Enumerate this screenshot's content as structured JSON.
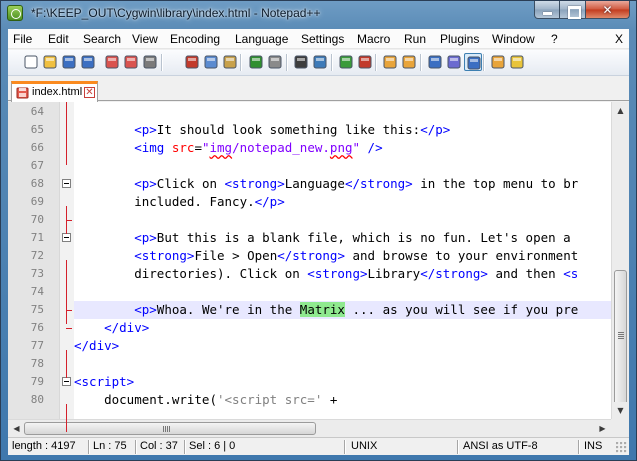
{
  "window": {
    "title": "*F:\\KEEP_OUT\\Cygwin\\library\\index.html - Notepad++",
    "minimize_glyph": "",
    "maximize_glyph": "",
    "close_glyph": "✕"
  },
  "menu": {
    "items": [
      "File",
      "Edit",
      "Search",
      "View",
      "Encoding",
      "Language",
      "Settings",
      "Macro",
      "Run",
      "Plugins",
      "Window",
      "?"
    ],
    "close": "X"
  },
  "toolbar": {
    "buttons": [
      {
        "name": "new-file-icon",
        "color": "#ffffff"
      },
      {
        "name": "open-file-icon",
        "color": "#f0c040"
      },
      {
        "name": "save-icon",
        "color": "#3b6fc2"
      },
      {
        "name": "save-all-icon",
        "color": "#3b6fc2"
      },
      {
        "name": "close-file-icon",
        "color": "#d9534f"
      },
      {
        "name": "close-all-icon",
        "color": "#d9534f"
      },
      {
        "name": "print-icon",
        "color": "#7a7a7a"
      },
      {
        "name": "cut-icon",
        "color": "#c23a2b"
      },
      {
        "name": "copy-icon",
        "color": "#5b8bd0"
      },
      {
        "name": "paste-icon",
        "color": "#c8a14a"
      },
      {
        "name": "undo-icon",
        "color": "#2f8f2f"
      },
      {
        "name": "redo-icon",
        "color": "#8a8a8a"
      },
      {
        "name": "find-icon",
        "color": "#3d3d3d"
      },
      {
        "name": "replace-icon",
        "color": "#3d7ab8"
      },
      {
        "name": "zoom-in-icon",
        "color": "#3b9b3b"
      },
      {
        "name": "zoom-out-icon",
        "color": "#c23a2b"
      },
      {
        "name": "sync-vertical-icon",
        "color": "#e8a43a"
      },
      {
        "name": "sync-horizontal-icon",
        "color": "#e8a43a"
      },
      {
        "name": "word-wrap-icon",
        "color": "#3b6fc2"
      },
      {
        "name": "show-all-chars-icon",
        "color": "#6b6bd0"
      },
      {
        "name": "indent-guide-icon",
        "color": "#3b6fc2"
      },
      {
        "name": "language-define-icon",
        "color": "#e8a43a"
      },
      {
        "name": "macro-record-icon",
        "color": "#e8c43a"
      }
    ]
  },
  "tab": {
    "label": "index.html",
    "close_glyph": "✕",
    "color": "#fa8a1f"
  },
  "editor": {
    "lines": [
      {
        "num": "64",
        "segs": []
      },
      {
        "num": "65",
        "segs": [
          [
            "",
            "        "
          ],
          [
            "tg",
            "<p>"
          ],
          [
            "",
            "It should look something like this:"
          ],
          [
            "tg",
            "</p>"
          ]
        ]
      },
      {
        "num": "66",
        "segs": [
          [
            "",
            "        "
          ],
          [
            "tg",
            "<img "
          ],
          [
            "at",
            "src"
          ],
          [
            "",
            "="
          ],
          [
            "av",
            "\""
          ],
          [
            "av sq",
            "img"
          ],
          [
            "av",
            "/notepad_new."
          ],
          [
            "av sq",
            "png"
          ],
          [
            "av",
            "\""
          ],
          [
            "tg",
            " />"
          ]
        ]
      },
      {
        "num": "67",
        "segs": []
      },
      {
        "num": "68",
        "segs": [
          [
            "",
            "        "
          ],
          [
            "tg",
            "<p>"
          ],
          [
            "",
            "Click on "
          ],
          [
            "tg",
            "<strong>"
          ],
          [
            "",
            "Language"
          ],
          [
            "tg",
            "</strong>"
          ],
          [
            "",
            " in the top menu to br"
          ]
        ]
      },
      {
        "num": "69",
        "segs": [
          [
            "",
            "        included. Fancy."
          ],
          [
            "tg",
            "</p>"
          ]
        ]
      },
      {
        "num": "70",
        "segs": []
      },
      {
        "num": "71",
        "segs": [
          [
            "",
            "        "
          ],
          [
            "tg",
            "<p>"
          ],
          [
            "",
            "But this is a blank file, which is no fun. Let's open a "
          ]
        ]
      },
      {
        "num": "72",
        "segs": [
          [
            "",
            "        "
          ],
          [
            "tg",
            "<strong>"
          ],
          [
            "",
            "File > Open"
          ],
          [
            "tg",
            "</strong>"
          ],
          [
            "",
            " and browse to your environment"
          ]
        ]
      },
      {
        "num": "73",
        "segs": [
          [
            "",
            "        directories). Click on "
          ],
          [
            "tg",
            "<strong>"
          ],
          [
            "",
            "Library"
          ],
          [
            "tg",
            "</strong>"
          ],
          [
            "",
            " and then "
          ],
          [
            "tg",
            "<s"
          ]
        ]
      },
      {
        "num": "74",
        "segs": []
      },
      {
        "num": "75",
        "segs": [
          [
            "",
            "        "
          ],
          [
            "tg",
            "<p>"
          ],
          [
            "",
            "Whoa. We're in the "
          ],
          [
            "hl",
            "Matrix"
          ],
          [
            "",
            " ... as you will see if you pre"
          ]
        ]
      },
      {
        "num": "76",
        "segs": [
          [
            "",
            "    "
          ],
          [
            "tg",
            "</div>"
          ]
        ]
      },
      {
        "num": "77",
        "segs": [
          [
            "tg",
            "</div>"
          ]
        ]
      },
      {
        "num": "78",
        "segs": []
      },
      {
        "num": "79",
        "segs": [
          [
            "tg",
            "<script>"
          ]
        ]
      },
      {
        "num": "80",
        "segs": [
          [
            "",
            "    document.write("
          ],
          [
            "js-str",
            "'<script src='"
          ],
          [
            "",
            " +"
          ]
        ]
      }
    ],
    "current_line": "75"
  },
  "status": {
    "length": "length : 4197",
    "line": "Ln : 75",
    "col": "Col : 37",
    "sel": "Sel : 6 | 0",
    "eol": "UNIX",
    "encoding": "ANSI as UTF-8",
    "mode": "INS"
  }
}
